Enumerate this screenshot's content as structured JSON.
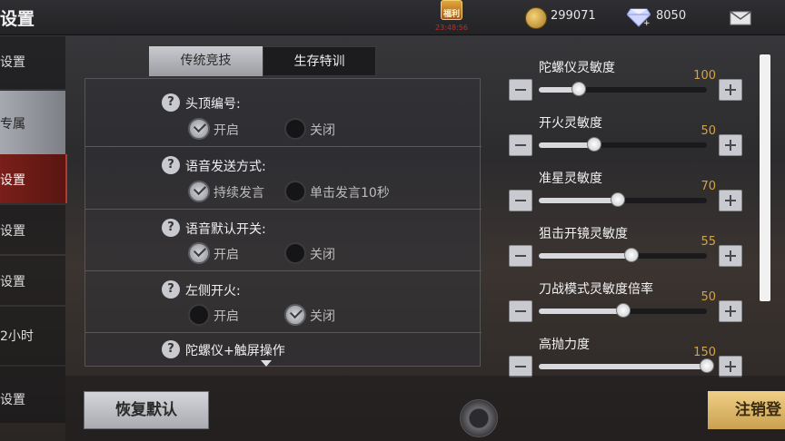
{
  "header": {
    "title": "设置",
    "reward_label": "福利",
    "reward_timer": "23:48:56",
    "coins": "299071",
    "diamonds": "8050"
  },
  "sidebar": {
    "items": [
      {
        "label": "设置"
      },
      {
        "label": "专属"
      },
      {
        "label": "设置"
      },
      {
        "label": "设置"
      },
      {
        "label": "设置"
      },
      {
        "label": "2小时"
      },
      {
        "label": "设置"
      }
    ]
  },
  "tabs": [
    {
      "label": "传统竞技",
      "active": true
    },
    {
      "label": "生存特训",
      "active": false
    }
  ],
  "settings": [
    {
      "label": "头顶编号:",
      "options": [
        "开启",
        "关闭"
      ],
      "selected": 0
    },
    {
      "label": "语音发送方式:",
      "options": [
        "持续发言",
        "单击发言10秒"
      ],
      "selected": 0
    },
    {
      "label": "语音默认开关:",
      "options": [
        "开启",
        "关闭"
      ],
      "selected": 0
    },
    {
      "label": "左侧开火:",
      "options": [
        "开启",
        "关闭"
      ],
      "selected": 1
    },
    {
      "label": "陀螺仪+触屏操作",
      "options": [],
      "selected": null
    }
  ],
  "sliders": [
    {
      "label": "陀螺仪灵敏度",
      "value": "100",
      "fraction": 0.24
    },
    {
      "label": "开火灵敏度",
      "value": "50",
      "fraction": 0.33
    },
    {
      "label": "准星灵敏度",
      "value": "70",
      "fraction": 0.47
    },
    {
      "label": "狙击开镜灵敏度",
      "value": "55",
      "fraction": 0.55
    },
    {
      "label": "刀战模式灵敏度倍率",
      "value": "50",
      "fraction": 0.5
    },
    {
      "label": "高抛力度",
      "value": "150",
      "fraction": 1.0
    }
  ],
  "buttons": {
    "reset": "恢复默认",
    "logout": "注销登"
  },
  "colors": {
    "accent_gold": "#d8a33a",
    "selected_red": "#7a1f1a"
  }
}
